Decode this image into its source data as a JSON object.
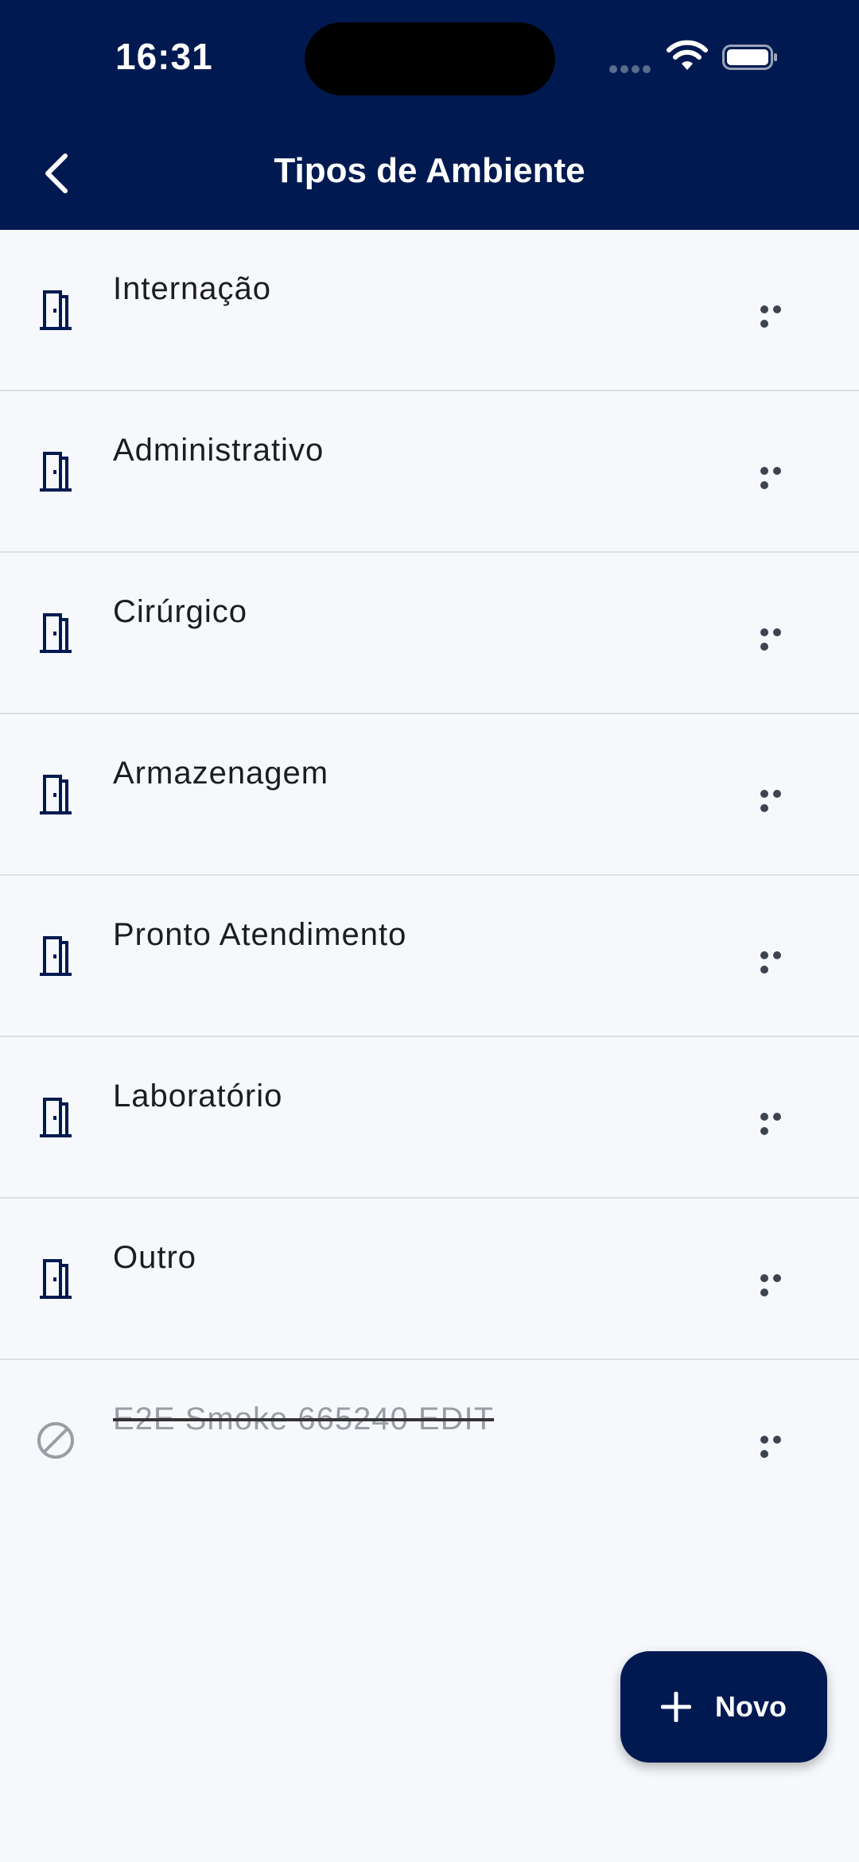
{
  "status_bar": {
    "time": "16:31"
  },
  "header": {
    "title": "Tipos de Ambiente",
    "back_icon": "chevron-left-icon"
  },
  "list": {
    "items": [
      {
        "label": "Internação",
        "icon": "door-icon",
        "disabled": false
      },
      {
        "label": "Administrativo",
        "icon": "door-icon",
        "disabled": false
      },
      {
        "label": "Cirúrgico",
        "icon": "door-icon",
        "disabled": false
      },
      {
        "label": "Armazenagem",
        "icon": "door-icon",
        "disabled": false
      },
      {
        "label": "Pronto Atendimento",
        "icon": "door-icon",
        "disabled": false
      },
      {
        "label": "Laboratório",
        "icon": "door-icon",
        "disabled": false
      },
      {
        "label": "Outro",
        "icon": "door-icon",
        "disabled": false
      },
      {
        "label": "E2E Smoke 665240 EDIT",
        "icon": "disabled-circle-icon",
        "disabled": true
      }
    ]
  },
  "fab": {
    "label": "Novo",
    "icon": "plus-icon"
  },
  "colors": {
    "primary": "#001A51",
    "background": "#F6F8FC",
    "divider": "#DCE0E6"
  }
}
